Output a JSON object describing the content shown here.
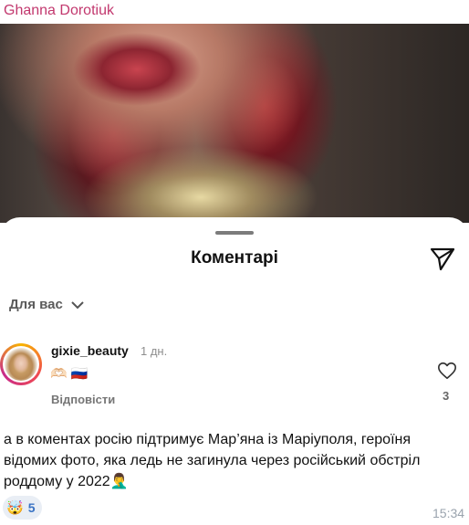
{
  "sender_name": "Ghanna Dorotiuk",
  "post": {
    "sheet_title": "Коментарі",
    "filter_label": "Для вас",
    "comment": {
      "username": "gixie_beauty",
      "time": "1 дн.",
      "text": "🫶🏻 🇷🇺",
      "reply_label": "Відповісти",
      "likes": "3"
    }
  },
  "message": {
    "text": "а в коментах росію підтримує Мар’яна із Маріуполя, героїня відомих фото, яка ледь не загинула через російський обстріл роддому у 2022🤦‍♂️",
    "reaction_emoji": "🤯",
    "reaction_count": "5",
    "time": "15:34"
  },
  "colors": {
    "sender": "#c2386e",
    "reaction_bg": "#e9eef5",
    "reaction_count": "#3a73c4"
  },
  "icons": [
    "send-icon",
    "chevron-down-icon",
    "heart-icon"
  ]
}
